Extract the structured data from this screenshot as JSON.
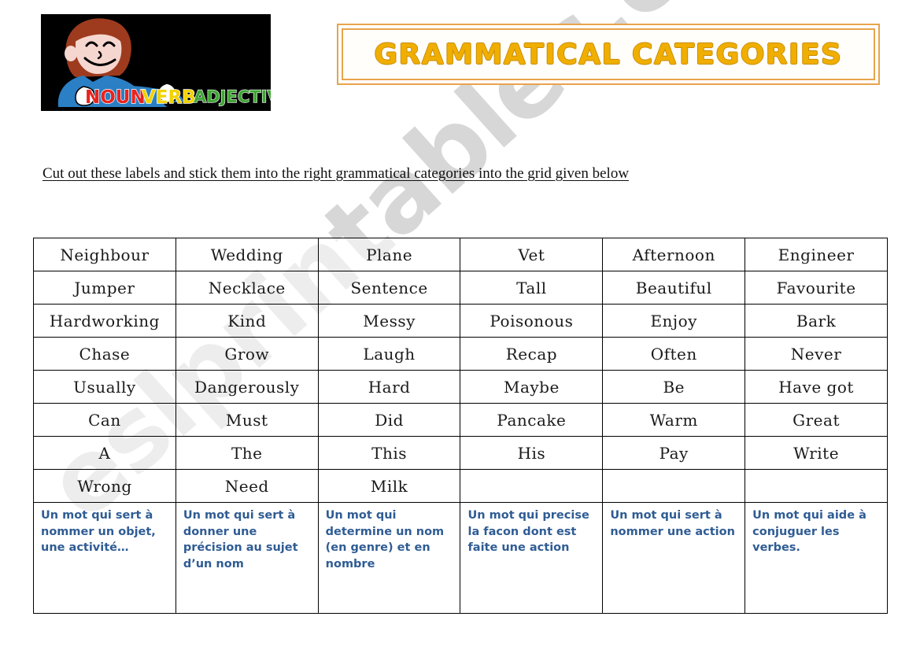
{
  "page": {
    "title": "GRAMMATICAL CATEGORIES",
    "instruction": "Cut out these labels and stick them into the right grammatical categories into the grid given below",
    "watermark": "eslprintables.com"
  },
  "logo": {
    "alt": "Cartoon boy leaning on the words NOUN VERB ADJECTIVE",
    "word_noun": "NOUN",
    "word_verb": "VERB",
    "word_adjective": "ADJECTIVE",
    "colors": {
      "background": "#000000",
      "noun": "#E8231F",
      "verb": "#F2D200",
      "adjective": "#3FA535",
      "hair": "#9E3B1E",
      "skin": "#F6D7D0",
      "shirt": "#2B7FC4"
    }
  },
  "theme": {
    "title_color": "#F0AF00",
    "banner_border": "#E8A44B",
    "definition_blue": "#2F5C94",
    "grid_line": "#000000",
    "watermark_gray": "#c9c9c9"
  },
  "grid": {
    "columns": 6,
    "word_rows": [
      [
        "Neighbour",
        "Wedding",
        "Plane",
        "Vet",
        "Afternoon",
        "Engineer"
      ],
      [
        "Jumper",
        "Necklace",
        "Sentence",
        "Tall",
        "Beautiful",
        "Favourite"
      ],
      [
        "Hardworking",
        "Kind",
        "Messy",
        "Poisonous",
        "Enjoy",
        "Bark"
      ],
      [
        "Chase",
        "Grow",
        "Laugh",
        "Recap",
        "Often",
        "Never"
      ],
      [
        "Usually",
        "Dangerously",
        "Hard",
        "Maybe",
        "Be",
        "Have got"
      ],
      [
        "Can",
        "Must",
        "Did",
        "Pancake",
        "Warm",
        "Great"
      ],
      [
        "A",
        "The",
        "This",
        "His",
        "Pay",
        "Write"
      ],
      [
        "Wrong",
        "Need",
        "Milk",
        "",
        "",
        ""
      ]
    ],
    "definitions": [
      "Un mot qui sert à nommer un objet, une activité…",
      "Un mot qui sert à donner une précision au sujet d’un nom",
      "Un mot qui determine un nom (en genre) et en nombre",
      "Un mot qui precise la facon dont est faite une action",
      "Un mot qui sert à nommer une action",
      "Un mot qui aide à conjuguer les verbes."
    ]
  }
}
